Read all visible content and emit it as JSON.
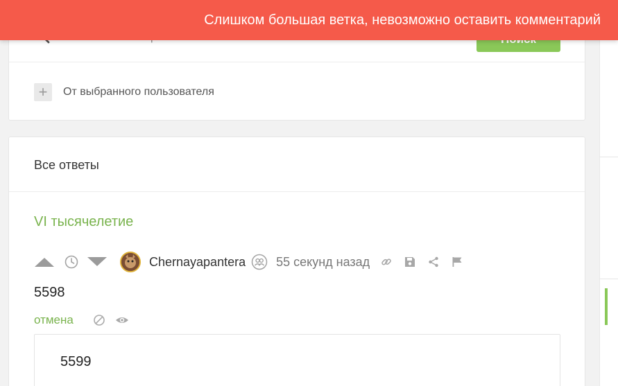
{
  "search": {
    "placeholder": "Текст комментария",
    "button_label": "Поиск"
  },
  "filter": {
    "user_filter_label": "От выбранного пользователя"
  },
  "answers": {
    "title": "Все ответы",
    "story_title": "VI тысячелетие",
    "comment": {
      "author": "Chernayapantera",
      "time": "55 секунд назад",
      "text": "5598",
      "cancel_label": "отмена"
    },
    "reply": {
      "text": "5599"
    }
  },
  "toast": {
    "message": "Слишком большая ветка, невозможно оставить комментарий"
  },
  "colors": {
    "accent_green": "#8ac858",
    "link_green": "#79b34d",
    "toast_red": "#f55a4a"
  },
  "icons": [
    "search-icon",
    "plus-icon",
    "vote-up-icon",
    "clock-icon",
    "vote-down-icon",
    "avatar",
    "subscribers-icon",
    "link-icon",
    "save-icon",
    "share-icon",
    "flag-icon",
    "ban-icon",
    "eye-icon"
  ]
}
